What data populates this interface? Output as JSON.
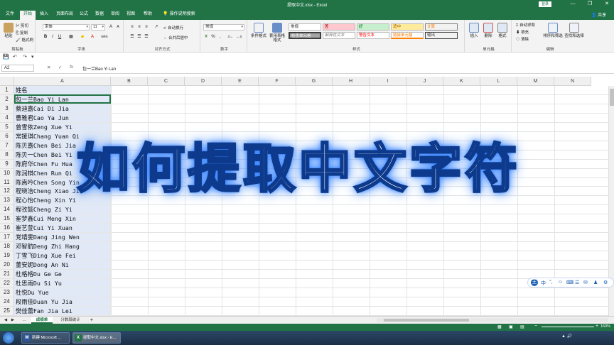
{
  "window": {
    "title": "提取中文.xlsx - Excel",
    "login_label": "登录",
    "controls": [
      "—",
      "❐",
      "✕"
    ]
  },
  "menu": {
    "tabs": [
      "文件",
      "开始",
      "插入",
      "页面布局",
      "公式",
      "数据",
      "审阅",
      "视图",
      "帮助",
      "操作说明搜索"
    ],
    "active_tab": "开始",
    "share": "共享"
  },
  "ribbon": {
    "clipboard": {
      "paste": "粘贴",
      "cut": "剪切",
      "copy": "复制",
      "format_painter": "格式刷",
      "label": "剪贴板"
    },
    "font": {
      "name": "宋体",
      "size": "11",
      "bold": "B",
      "italic": "I",
      "underline": "U",
      "wen": "wén",
      "label": "字体"
    },
    "alignment": {
      "wrap": "自动换行",
      "merge": "合并后居中",
      "label": "对齐方式"
    },
    "number": {
      "format": "常规",
      "percent": "%",
      "comma": ",",
      "label": "数字"
    },
    "styles": {
      "conditional": "条件格式",
      "table": "套用表格格式",
      "boxes": [
        "常规",
        "差",
        "好",
        "适中",
        "计算",
        "检查单元格",
        "解释性文本",
        "警告文本",
        "链接单元格",
        "输出"
      ],
      "label": "样式"
    },
    "cells": {
      "insert": "插入",
      "delete": "删除",
      "format": "格式",
      "label": "单元格"
    },
    "editing": {
      "autosum": "自动求和",
      "fill": "填充",
      "clear": "清除",
      "sort": "排序和筛选",
      "find": "查找和选择",
      "label": "编辑"
    }
  },
  "formula_bar": {
    "name_box": "A2",
    "cancel": "✕",
    "enter": "✓",
    "fx": "fx",
    "content": "包一兰Bao Yi Lan"
  },
  "grid": {
    "columns": [
      "A",
      "B",
      "C",
      "D",
      "E",
      "F",
      "G",
      "H",
      "I",
      "J",
      "K",
      "L",
      "M",
      "N"
    ],
    "rows": [
      {
        "n": "1",
        "a": "姓名"
      },
      {
        "n": "2",
        "a": "包一兰Bao Yi Lan"
      },
      {
        "n": "3",
        "a": "蔡迪嘉Cai Di Jia"
      },
      {
        "n": "4",
        "a": "曹雅君Cao Ya Jun"
      },
      {
        "n": "5",
        "a": "曾雪依Zeng Xue Yi"
      },
      {
        "n": "6",
        "a": "常援琪Chang Yuan Qi"
      },
      {
        "n": "7",
        "a": "陈贝嘉Chen Bei Jia"
      },
      {
        "n": "8",
        "a": "陈贝一Chen Bei Yi"
      },
      {
        "n": "9",
        "a": "陈府华Chen Fu Hua"
      },
      {
        "n": "10",
        "a": "陈润棋Chen Run Qi"
      },
      {
        "n": "11",
        "a": "陈嵩吟Chen Song Yin"
      },
      {
        "n": "12",
        "a": "程晓洁Cheng Xiao Jie"
      },
      {
        "n": "13",
        "a": "程心怡Cheng Xin Yi"
      },
      {
        "n": "14",
        "a": "程孜懿Cheng Zi Yi"
      },
      {
        "n": "15",
        "a": "崔梦鑫Cui Meng Xin"
      },
      {
        "n": "16",
        "a": "崔艺萱Cui Yi Xuan"
      },
      {
        "n": "17",
        "a": "党靖雯Dang Jing Wen"
      },
      {
        "n": "18",
        "a": "邓智航Deng Zhi Hang"
      },
      {
        "n": "19",
        "a": "丁雪飞Ding Xue Fei"
      },
      {
        "n": "20",
        "a": "董安妮Dong An Ni"
      },
      {
        "n": "21",
        "a": "杜格格Du Ge Ge"
      },
      {
        "n": "22",
        "a": "杜思雨Du Si Yu"
      },
      {
        "n": "23",
        "a": "杜悦Du Yue"
      },
      {
        "n": "24",
        "a": "段雨佳Duan Yu Jia"
      },
      {
        "n": "25",
        "a": "樊佳蕾Fan Jia Lei"
      }
    ]
  },
  "overlay_title": "如何提取中文字符",
  "ime_toolbar": [
    "王",
    "中",
    "°,",
    "☺",
    "⌨",
    "☰",
    "✉",
    "♟",
    "⚙"
  ],
  "sheets": {
    "tabs": [
      "成绩单",
      "分数段统计"
    ],
    "active": "成绩单",
    "add": "+"
  },
  "status": {
    "zoom": "160%"
  },
  "taskbar": {
    "items": [
      {
        "icon": "W",
        "label": "新建 Microsoft ..."
      },
      {
        "icon": "X",
        "label": "提取中文.xlsx - E..."
      }
    ]
  },
  "colors": {
    "excel_green": "#217346",
    "title_glow": "#2a7bff",
    "selection": "#c8d7f0"
  }
}
